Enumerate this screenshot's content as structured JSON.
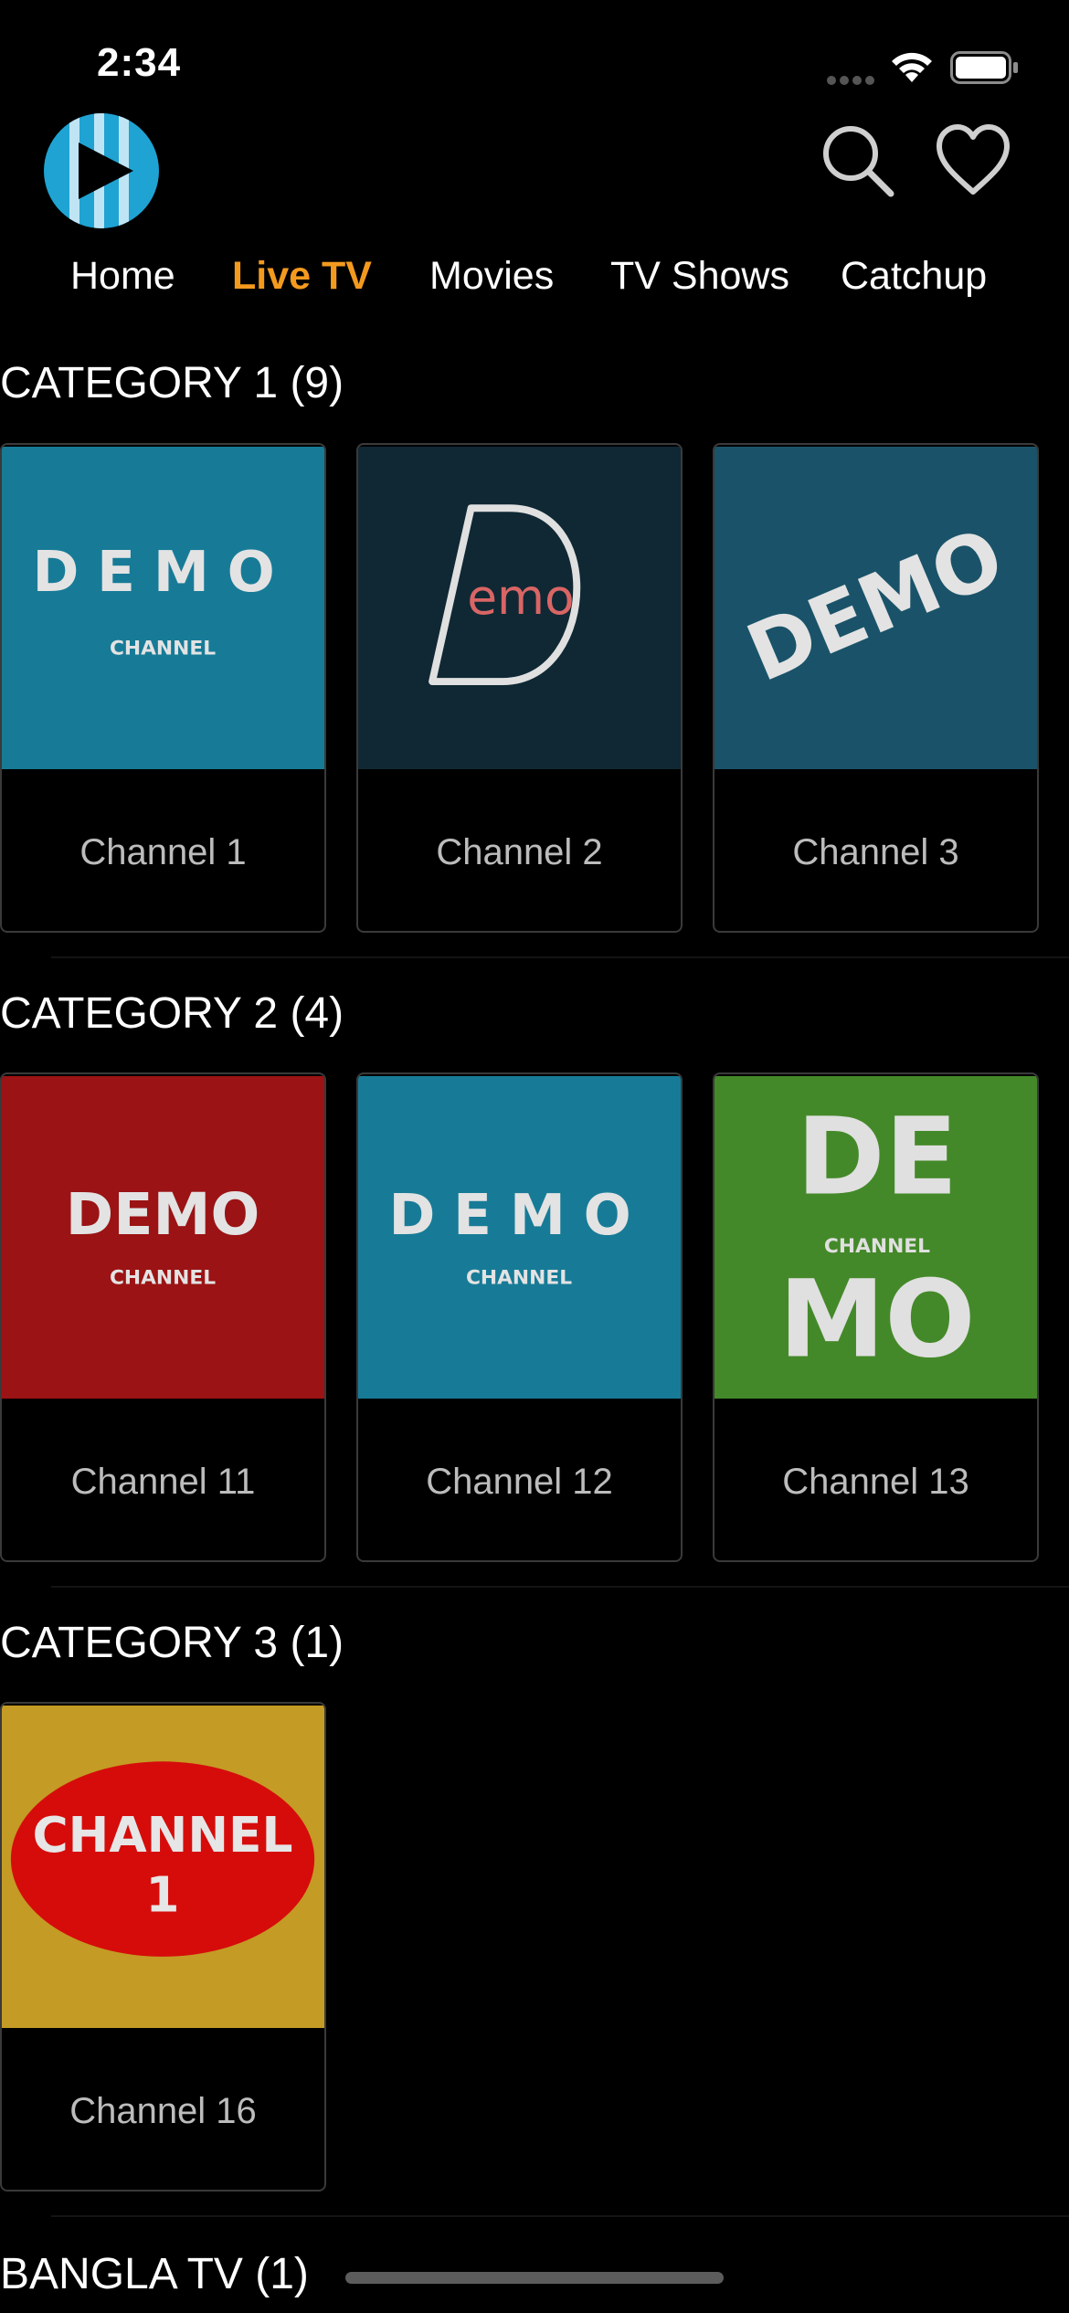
{
  "status_bar": {
    "time": "2:34"
  },
  "colors": {
    "accent": "#f39a1e",
    "background": "#000000",
    "logo_blue": "#1fa3d3"
  },
  "header": {
    "logo_icon": "play-logo-icon",
    "search_icon": "search-icon",
    "favorite_icon": "heart-icon"
  },
  "nav": {
    "tabs": [
      {
        "label": "Home",
        "active": false
      },
      {
        "label": "Live TV",
        "active": true
      },
      {
        "label": "Movies",
        "active": false
      },
      {
        "label": "TV Shows",
        "active": false
      },
      {
        "label": "Catchup",
        "active": false
      }
    ]
  },
  "sections": [
    {
      "title": "CATEGORY 1 (9)",
      "channels": [
        {
          "name": "Channel 1",
          "logo_line1": "DEMO",
          "logo_line2": "CHANNEL",
          "bg": "#177b97"
        },
        {
          "name": "Channel 2",
          "logo_line1": "emo",
          "bg": "#0f2834"
        },
        {
          "name": "Channel 3",
          "logo_line1": "DEMO",
          "bg": "#1a5369"
        }
      ]
    },
    {
      "title": "CATEGORY 2 (4)",
      "channels": [
        {
          "name": "Channel 11",
          "logo_line1": "DEMO",
          "logo_line2": "CHANNEL",
          "bg": "#9b1314"
        },
        {
          "name": "Channel 12",
          "logo_line1": "DEMO",
          "logo_line2": "CHANNEL",
          "bg": "#177b97"
        },
        {
          "name": "Channel 13",
          "logo_line1": "DE",
          "logo_line2": "CHANNEL",
          "logo_line3": "MO",
          "bg": "#448929"
        }
      ]
    },
    {
      "title": "CATEGORY 3 (1)",
      "channels": [
        {
          "name": "Channel 16",
          "logo_line1": "CHANNEL",
          "logo_line2": "1",
          "bg": "#c49b24"
        }
      ]
    },
    {
      "title": "BANGLA TV (1)",
      "channels": []
    }
  ]
}
